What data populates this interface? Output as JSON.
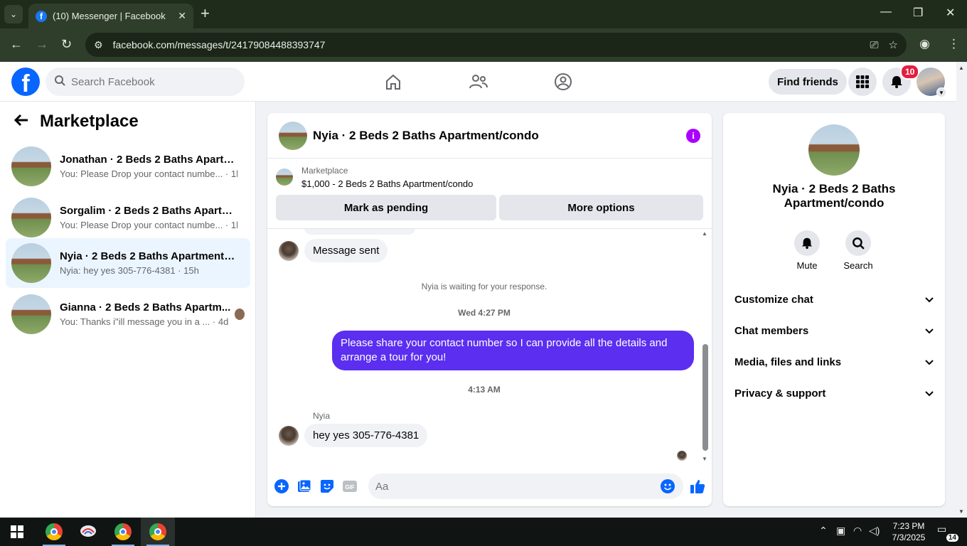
{
  "browser": {
    "tab_title": "(10) Messenger | Facebook",
    "url": "facebook.com/messages/t/24179084488393747"
  },
  "header": {
    "logo": "f",
    "search_placeholder": "Search Facebook",
    "find_friends": "Find friends",
    "notification_count": "10"
  },
  "sidebar": {
    "title": "Marketplace",
    "conversations": [
      {
        "name": "Jonathan · 2 Beds 2 Baths Apartm...",
        "preview": "You: Please Drop your contact numbe... · 1h"
      },
      {
        "name": "Sorgalim · 2 Beds 2 Baths Apartme...",
        "preview": "You: Please Drop your contact numbe... · 1h"
      },
      {
        "name": "Nyia · 2 Beds 2 Baths Apartment/c...",
        "preview": "Nyia: hey yes 305-776-4381 · 15h"
      },
      {
        "name": "Gianna · 2 Beds 2 Baths Apartm...",
        "preview": "You: Thanks i\"ill message you in a ... · 4d"
      }
    ]
  },
  "chat": {
    "title": "Nyia · 2 Beds 2 Baths Apartment/condo",
    "listing_label": "Marketplace",
    "listing_price": "$1,000 - 2 Beds 2 Baths Apartment/condo",
    "mark_pending": "Mark as pending",
    "more_options": "More options",
    "messages": {
      "message_sent": "Message sent",
      "waiting": "Nyia is waiting for your response.",
      "time1": "Wed 4:27 PM",
      "outgoing": "Please share your contact number so I can provide all the details and arrange a tour for you!",
      "time2": "4:13 AM",
      "sender": "Nyia",
      "incoming": "hey yes 305-776-4381"
    },
    "composer_placeholder": "Aa",
    "gif_label": "GIF"
  },
  "right_panel": {
    "name": "Nyia · 2 Beds 2 Baths Apartment/condo",
    "mute": "Mute",
    "search": "Search",
    "sections": [
      "Customize chat",
      "Chat members",
      "Media, files and links",
      "Privacy & support"
    ]
  },
  "taskbar": {
    "time": "7:23 PM",
    "date": "7/3/2025",
    "notifications": "14"
  },
  "colors": {
    "fb_blue": "#0866ff",
    "outgoing_bubble": "#5b2ef0",
    "info_purple": "#a900ff",
    "notify_red": "#e41e3f"
  }
}
